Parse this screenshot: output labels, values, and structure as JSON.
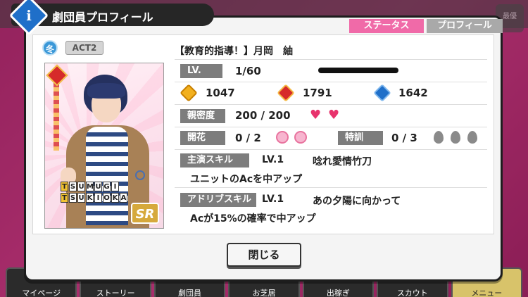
{
  "background": {
    "top_right_label": "最優",
    "bottom_nav": [
      {
        "label": "マイページ"
      },
      {
        "label": "ストーリー"
      },
      {
        "label": "劇団員"
      },
      {
        "label": "お芝居"
      },
      {
        "label": "出稼ぎ"
      },
      {
        "label": "スカウト"
      },
      {
        "label": "メニュー",
        "active": true
      }
    ]
  },
  "dialog": {
    "title": "劇団員プロフィール",
    "info_icon": "i",
    "tabs": {
      "status": "ステータス",
      "profile": "プロフィール"
    },
    "close_label": "閉じる"
  },
  "card": {
    "season": "冬",
    "act": "ACT2",
    "name_line1": [
      "T",
      "S",
      "U",
      "M",
      "U",
      "G",
      "I"
    ],
    "name_line2": [
      "T",
      "S",
      "U",
      "K",
      "I",
      "O",
      "K",
      "A"
    ],
    "rarity": "SR",
    "attribute_icon": "passion-diamond-icon"
  },
  "character": {
    "title": "【教育的指導！】月岡　紬"
  },
  "stats": {
    "level_label": "LV.",
    "level_value": "1/60",
    "performance": "1047",
    "passion": "1791",
    "technique": "1642",
    "intimacy_label": "親密度",
    "intimacy_value": "200 / 200",
    "bloom_label": "開花",
    "bloom_value": "0 / 2",
    "training_label": "特訓",
    "training_value": "0 / 3",
    "colors": {
      "perf": "#f2b01e",
      "pass": "#d62a2a",
      "tech": "#1f6fc9"
    }
  },
  "skills": {
    "lead_label": "主演スキル",
    "lead_level": "LV.1",
    "lead_name": "唸れ愛情竹刀",
    "lead_desc": "ユニットのAcを中アップ",
    "adlib_label": "アドリブスキル",
    "adlib_level": "LV.1",
    "adlib_name": "あの夕陽に向かって",
    "adlib_desc": "Acが15%の確率で中アップ"
  }
}
